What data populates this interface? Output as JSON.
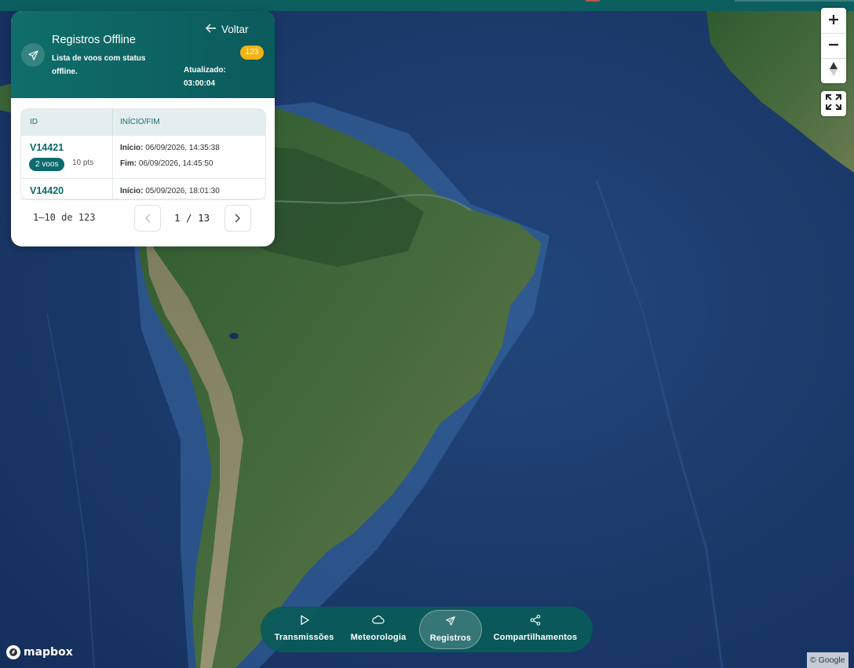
{
  "panel": {
    "title": "Registros Offline",
    "subtitle": "Lista de voos com status offline.",
    "back_label": "Voltar",
    "count_badge": "123",
    "updated_label": "Atualizado:",
    "updated_time": "03:00:04"
  },
  "table": {
    "headers": [
      "ID",
      "INÍCIO/FIM"
    ],
    "rows": [
      {
        "id": "V14421",
        "flights": "2 voos",
        "points": "10 pts",
        "start_label": "Início:",
        "start": "06/09/2026, 14:35:38",
        "end_label": "Fim:",
        "end": "06/09/2026, 14:45:50"
      },
      {
        "id": "V14420",
        "start_label": "Início:",
        "start": "05/09/2026, 18:01:30"
      }
    ]
  },
  "pagination": {
    "range": "1–10 de 123",
    "page_text": "1 / 13"
  },
  "map_controls": {
    "zoom_in": "+",
    "zoom_out": "−"
  },
  "bottom_nav": {
    "items": [
      {
        "label": "Transmissões",
        "icon": "play-icon"
      },
      {
        "label": "Meteorologia",
        "icon": "cloud-icon"
      },
      {
        "label": "Registros",
        "icon": "send-icon",
        "active": true
      },
      {
        "label": "Compartilhamentos",
        "icon": "share-icon"
      }
    ]
  },
  "map": {
    "logo_text": "mapbox",
    "attribution": "© Google"
  },
  "colors": {
    "primary": "#0b6a6d",
    "header": "#0f6e6a",
    "badge": "#f2b316",
    "ocean": "#1b3a6b",
    "land": "#3d6b3a"
  }
}
